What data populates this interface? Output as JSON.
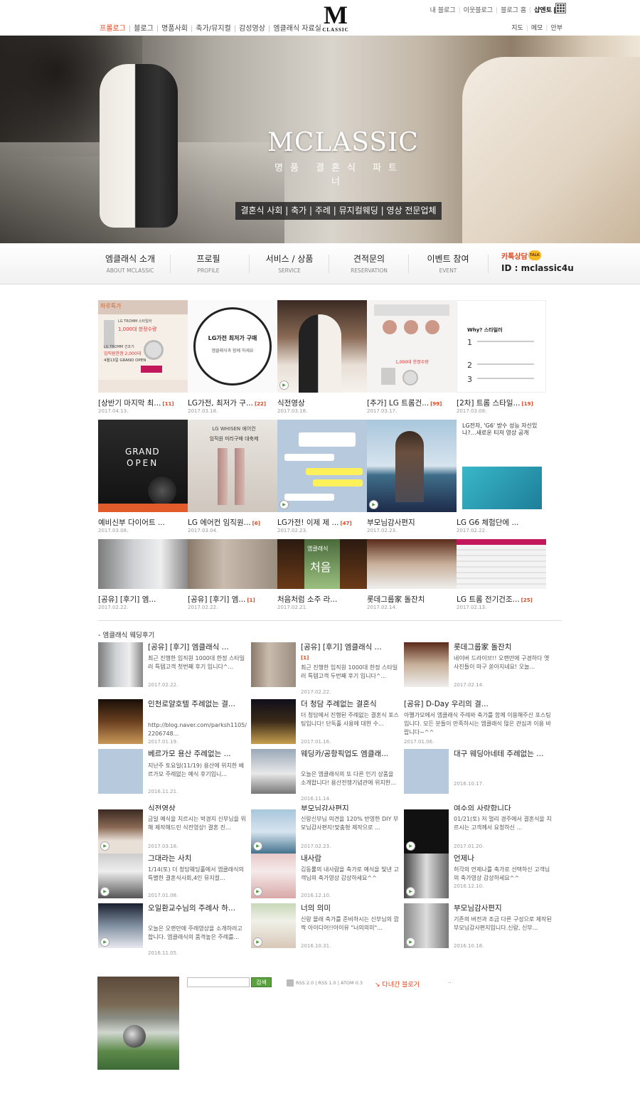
{
  "header": {
    "nav": [
      "프롤로그",
      "블로그",
      "명품사회",
      "축가/뮤지컬",
      "감성영상",
      "엠클래식 자료실"
    ],
    "logo_big": "M",
    "logo_small": "CLASSIC",
    "util": [
      "내 블로그",
      "이웃블로그",
      "블로그 홈",
      "샵엔토"
    ],
    "util2": [
      "지도",
      "메모",
      "안부"
    ]
  },
  "hero": {
    "title": "MCLASSIC",
    "subtitle": "명품 결혼식 파트너",
    "bar": "결혼식 사회 | 축가 | 주례 | 뮤지컬웨딩 | 영상 전문업체"
  },
  "gnb": {
    "items": [
      {
        "ko": "엠클래식 소개",
        "en": "ABOUT MCLASSIC"
      },
      {
        "ko": "프로필",
        "en": "PROFILE"
      },
      {
        "ko": "서비스 / 상품",
        "en": "SERVICE"
      },
      {
        "ko": "견적문의",
        "en": "RESERVATION"
      },
      {
        "ko": "이벤트 참여",
        "en": "EVENT"
      }
    ],
    "talk_label": "카톡상담",
    "talk_badge": "TALK",
    "talk_id": "ID : mclassic4u"
  },
  "thumbs": [
    {
      "title": "[상반기 마지막 최...",
      "count": "[11]",
      "date": "2017.04.13."
    },
    {
      "title": "LG가전, 최저가 구...",
      "count": "[22]",
      "date": "2017.03.18."
    },
    {
      "title": "식전영상",
      "count": "",
      "date": "2017.03.18."
    },
    {
      "title": "[추가] LG 트롬건...",
      "count": "[99]",
      "date": "2017.03.17."
    },
    {
      "title": "[2차] 트롬 스타일...",
      "count": "[19]",
      "date": "2017.03.08."
    },
    {
      "title": "예비신부 다이어트 ...",
      "count": "",
      "date": "2017.03.08."
    },
    {
      "title": "LG 에어컨 임직원...",
      "count": "[6]",
      "date": "2017.03.04."
    },
    {
      "title": "LG가전! 이제 제 ...",
      "count": "[47]",
      "date": "2017.02.23."
    },
    {
      "title": "부모님감사편지",
      "count": "",
      "date": "2017.02.23."
    },
    {
      "title": "LG G6 체험단에 ...",
      "count": "",
      "date": "2017.02.22."
    },
    {
      "title": "[공유] [후기] 엠...",
      "count": "",
      "date": "2017.02.22."
    },
    {
      "title": "[공유] [후기] 엠...",
      "count": "[1]",
      "date": "2017.02.22."
    },
    {
      "title": "처음처럼 소주 라...",
      "count": "",
      "date": "2017.02.21."
    },
    {
      "title": "롯데그룹家 돌잔치",
      "count": "",
      "date": "2017.02.14."
    },
    {
      "title": "LG 트롬 전기건조...",
      "count": "[25]",
      "date": "2017.02.13."
    }
  ],
  "thumb_texts": {
    "t1_head": "하루특가",
    "t1_a": "LG TROMM 스타일러",
    "t1_b": "1,000대 한정수량",
    "t1_c": "LG TROMM 건조기",
    "t1_d": "임직원한정 2,000대",
    "t1_e": "4월13일 GRAND OPEN",
    "t2_a": "LG가전 최저가 구매",
    "t2_b": "엠클래식과 함께 하세요",
    "t4_a": "1,000대 한정수량",
    "t5_a": "Why? 스타일러",
    "t6_a": "GRAND",
    "t6_b": "OPEN",
    "t7_a": "LG WHISEN 에어컨",
    "t7_b": "임직원 미리구매 대축제",
    "t10_a": "LG전자, 'G6' 방수 성능 자신있나?…새로운 티저 영상 공개",
    "t13_a": "엠클래식",
    "t13_b": "처음"
  },
  "section_title": "- 엠클래식 웨딩후기",
  "posts": [
    {
      "title": "[공유] [후기] 엠클래식 ...",
      "body": "최근 진행한 임직원 1000대 한정 스타일러 특템고객 첫번째 후기 입니다^...",
      "date": "2017.02.22."
    },
    {
      "title": "[공유] [후기] 엠클래식 ...",
      "count": "[1]",
      "body": "최근 진행한 임직원 1000대 한정 스타일러 특템고객 두번째 후기 입니다^...",
      "date": "2017.02.22."
    },
    {
      "title": "롯데그룹家 돌잔치",
      "body": "네이버 드라이브!! 오랜만에 구경하다 옛 사진들이 마구 쏟아지네요! 오늘...",
      "date": "2017.02.14."
    },
    {
      "title": "인천로얄호텔 주례없는 결...",
      "body": "http://blog.naver.com/parksh1105/2206748...",
      "date": "2017.01.19."
    },
    {
      "title": "더 청담 주례없는 결혼식",
      "body": "더 청담에서 진행된 주례없는 결혼식 포스팅입니다! 단독홀 사용에 대한 수...",
      "date": "2017.01.16."
    },
    {
      "title": "[공유] D-Day 우리의 결...",
      "body": "아펠가모에서 엠클래식 주례와 축가를 함께 이용해주신 포스팅입니다. 모든 분들이 만족하시는 엠클래식 많은 관심과 이용 바랍니다~^^",
      "date": "2017.01.06."
    },
    {
      "title": "베르가모 용산 주례없는 ...",
      "body": "지난주 토요일(11/19) 용산에 위치한 베르가모 주례없는 예식 후기입니...",
      "date": "2016.11.21."
    },
    {
      "title": "웨딩카/공항픽업도 엠클래...",
      "body": "오늘은 엠클래식의 또 다른 인기 상품을 소개합니다! 용산전쟁기념관에 위치한...",
      "date": "2016.11.14."
    },
    {
      "title": "대구 웨딩아네테 주례없는 ...",
      "body": "",
      "date": "2016.10.17."
    },
    {
      "title": "식전영상",
      "body": "금일 예식을 치르시는 박경지 신부님을 위해 제작해드린 식전영상! 결혼 진...",
      "date": "2017.03.18."
    },
    {
      "title": "부모님감사편지",
      "body": "신랑신부님 의견을 120% 반영한 DIY 부모님감사편지!맞춤형 제작으로 ...",
      "date": "2017.02.23."
    },
    {
      "title": "여수의 사랑합니다",
      "body": "01/21(토) 저 멀리 경주에서 결혼식을 치르시는 고객께서 요청하신 ...",
      "date": "2017.01.20."
    },
    {
      "title": "그대라는 사치",
      "body": "1/14(토) 더 청담웨딩홀에서 엠클래식의 특별한 결혼식사회,4인 뮤지컬...",
      "date": "2017.01.08."
    },
    {
      "title": "내사람",
      "body": "김동률의 내사람을 축가로 예식을 빛낸 고객님의 축가영상 감상하세요^^",
      "date": "2016.12.10."
    },
    {
      "title": "언제나",
      "body": "허각의 언제나를 축가로 선택하신 고객님의 축가영상 감상하세요^^",
      "date": "2016.12.10."
    },
    {
      "title": "오일환교수님의 주례사 하...",
      "body": "오늘은 오랜만에 주례영상을 소개하려고 합니다. 엠클래식의 품격높은 주례를...",
      "date": "2016.11.05."
    },
    {
      "title": "너의 의미",
      "body": "신랑 몰래 축가를 준비하시는 신부님의 깜짝 아이디어!!아이유 \"너의의미\"...",
      "date": "2016.10.31."
    },
    {
      "title": "부모님감사편지",
      "body": "기존의 버전과 조금 다른 구성으로 제작된 부모님감사편지입니다.신랑, 신부...",
      "date": "2016.10.18."
    }
  ],
  "bottom": {
    "search_placeholder": "",
    "search_button": "검색",
    "rss": [
      "RSS 2.0",
      "RSS 1.0",
      "ATOM 0.3"
    ],
    "prev_bloggers": "다녀간 블로거",
    "dots": ".."
  },
  "colors": {
    "accent": "#e0461e",
    "green": "#5aa23e",
    "talk": "#f6b824"
  }
}
